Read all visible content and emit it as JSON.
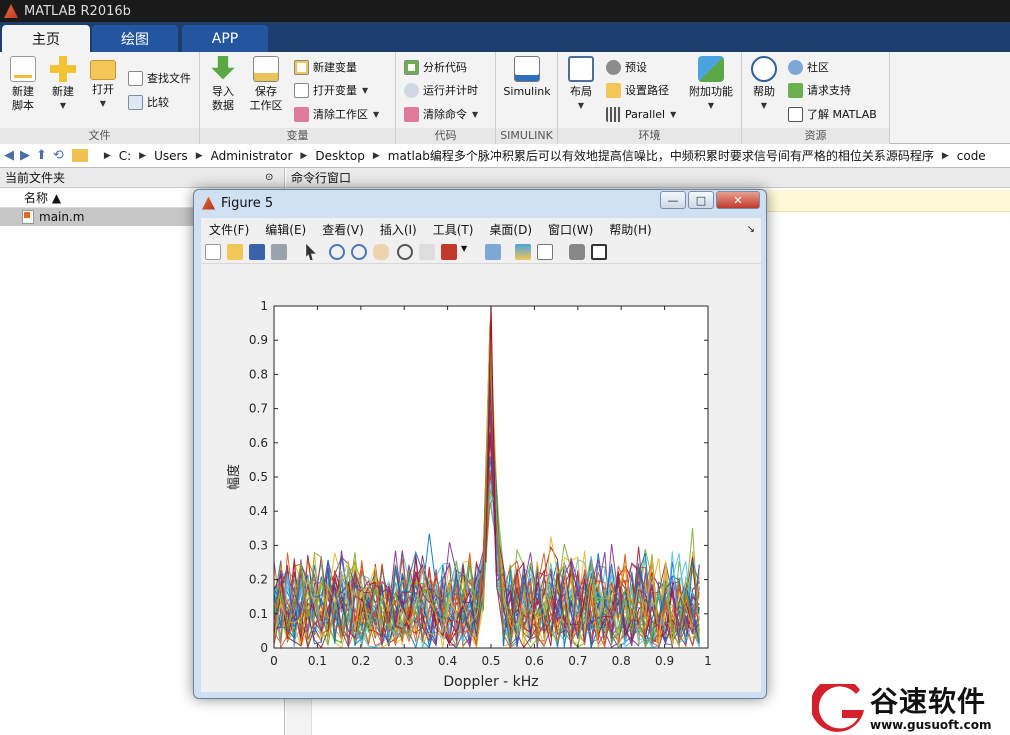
{
  "window": {
    "title": "MATLAB R2016b"
  },
  "tabs": [
    {
      "label": "主页",
      "active": true
    },
    {
      "label": "绘图",
      "active": false
    },
    {
      "label": "APP",
      "active": false
    }
  ],
  "ribbon": {
    "file": {
      "label": "文件",
      "new_script": "新建\n脚本",
      "new_script_l1": "新建",
      "new_script_l2": "脚本",
      "new": "新建",
      "open": "打开",
      "find_files": "查找文件",
      "compare": "比较"
    },
    "variable": {
      "label": "变量",
      "import_l1": "导入",
      "import_l2": "数据",
      "save_l1": "保存",
      "save_l2": "工作区",
      "new_var": "新建变量",
      "open_var": "打开变量",
      "clear_ws": "清除工作区"
    },
    "code": {
      "label": "代码",
      "analyze": "分析代码",
      "run_time": "运行并计时",
      "clear_cmd": "清除命令"
    },
    "simulink": {
      "label": "SIMULINK",
      "button": "Simulink"
    },
    "env": {
      "label": "环境",
      "layout": "布局",
      "prefs": "预设",
      "set_path": "设置路径",
      "parallel": "Parallel",
      "addons": "附加功能"
    },
    "resources": {
      "label": "资源",
      "help": "帮助",
      "community": "社区",
      "support": "请求支持",
      "learn": "了解 MATLAB"
    }
  },
  "address": {
    "parts": [
      "C:",
      "Users",
      "Administrator",
      "Desktop",
      "matlab编程多个脉冲积累后可以有效地提高信噪比，中频积累时要求信号间有严格的相位关系源码程序",
      "code"
    ]
  },
  "left_panel": {
    "title": "当前文件夹",
    "column": "名称 ▲",
    "files": [
      "main.m"
    ]
  },
  "cmd_panel": {
    "title": "命令行窗口"
  },
  "figure": {
    "title": "Figure 5",
    "menus": [
      "文件(F)",
      "编辑(E)",
      "查看(V)",
      "插入(I)",
      "工具(T)",
      "桌面(D)",
      "窗口(W)",
      "帮助(H)"
    ],
    "win_buttons": {
      "min": "—",
      "max": "□",
      "close": "✕"
    }
  },
  "chart_data": {
    "type": "line",
    "xlabel": "Doppler -  kHz",
    "ylabel": "幅度",
    "xlim": [
      0,
      1
    ],
    "ylim": [
      0,
      1
    ],
    "xticks": [
      "0",
      "0.1",
      "0.2",
      "0.3",
      "0.4",
      "0.5",
      "0.6",
      "0.7",
      "0.8",
      "0.9",
      "1"
    ],
    "yticks": [
      "0",
      "0.1",
      "0.2",
      "0.3",
      "0.4",
      "0.5",
      "0.6",
      "0.7",
      "0.8",
      "0.9",
      "1"
    ],
    "peak": {
      "x": 0.5,
      "y": 1.0
    },
    "noise_floor": 0.3,
    "series_count": 40,
    "colors": [
      "#0072bd",
      "#d95319",
      "#edb120",
      "#7e2f8e",
      "#77ac30",
      "#4dbeee",
      "#a2142f"
    ]
  },
  "watermark": {
    "cn": "谷速软件",
    "url": "www.gusuoft.com",
    "logo_letter": "G"
  }
}
